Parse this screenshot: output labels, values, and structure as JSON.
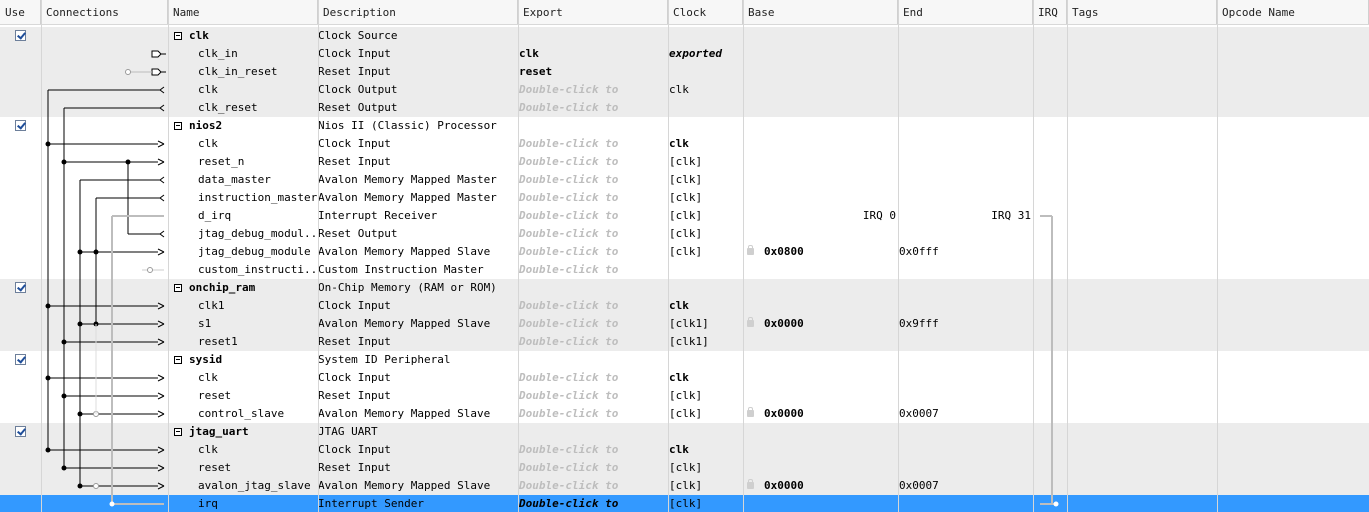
{
  "columns": [
    "Use",
    "Connections",
    "Name",
    "Description",
    "Export",
    "Clock",
    "Base",
    "End",
    "IRQ",
    "Tags",
    "Opcode Name"
  ],
  "placeholder_export": "Double-click to",
  "rows": [
    {
      "kind": "comp",
      "use": true,
      "name": "clk",
      "desc": "Clock Source",
      "export": "",
      "clock": "",
      "base": "",
      "end": "",
      "irq": ""
    },
    {
      "kind": "port",
      "name": "clk_in",
      "desc": "Clock Input",
      "export": "clk",
      "export_style": "bold",
      "clock": "exported",
      "clock_style": "italic"
    },
    {
      "kind": "port",
      "name": "clk_in_reset",
      "desc": "Reset Input",
      "export": "reset",
      "export_style": "bold",
      "clock": ""
    },
    {
      "kind": "port",
      "name": "clk",
      "desc": "Clock Output",
      "export": "Double-click to",
      "export_style": "placeholder",
      "clock": "clk"
    },
    {
      "kind": "port",
      "name": "clk_reset",
      "desc": "Reset Output",
      "export": "Double-click to",
      "export_style": "placeholder",
      "clock": ""
    },
    {
      "kind": "comp",
      "use": true,
      "name": "nios2",
      "desc": "Nios II (Classic) Processor"
    },
    {
      "kind": "port",
      "name": "clk",
      "desc": "Clock Input",
      "export": "Double-click to",
      "export_style": "placeholder",
      "clock": "clk",
      "clock_style": "bold"
    },
    {
      "kind": "port",
      "name": "reset_n",
      "desc": "Reset Input",
      "export": "Double-click to",
      "export_style": "placeholder",
      "clock": "[clk]"
    },
    {
      "kind": "port",
      "name": "data_master",
      "desc": "Avalon Memory Mapped Master",
      "export": "Double-click to",
      "export_style": "placeholder",
      "clock": "[clk]"
    },
    {
      "kind": "port",
      "name": "instruction_master",
      "desc": "Avalon Memory Mapped Master",
      "export": "Double-click to",
      "export_style": "placeholder",
      "clock": "[clk]"
    },
    {
      "kind": "port",
      "name": "d_irq",
      "desc": "Interrupt Receiver",
      "export": "Double-click to",
      "export_style": "placeholder",
      "clock": "[clk]",
      "base_right": "IRQ 0",
      "end_right": "IRQ 31"
    },
    {
      "kind": "port",
      "name": "jtag_debug_modul...",
      "desc": "Reset Output",
      "export": "Double-click to",
      "export_style": "placeholder",
      "clock": "[clk]"
    },
    {
      "kind": "port",
      "name": "jtag_debug_module",
      "desc": "Avalon Memory Mapped Slave",
      "export": "Double-click to",
      "export_style": "placeholder",
      "clock": "[clk]",
      "base": "0x0800",
      "end": "0x0fff"
    },
    {
      "kind": "port",
      "name": "custom_instructi...",
      "desc": "Custom Instruction Master",
      "export": "Double-click to",
      "export_style": "placeholder",
      "clock": ""
    },
    {
      "kind": "comp",
      "use": true,
      "name": "onchip_ram",
      "desc": "On-Chip Memory (RAM or ROM)"
    },
    {
      "kind": "port",
      "name": "clk1",
      "desc": "Clock Input",
      "export": "Double-click to",
      "export_style": "placeholder",
      "clock": "clk",
      "clock_style": "bold"
    },
    {
      "kind": "port",
      "name": "s1",
      "desc": "Avalon Memory Mapped Slave",
      "export": "Double-click to",
      "export_style": "placeholder",
      "clock": "[clk1]",
      "base": "0x0000",
      "end": "0x9fff"
    },
    {
      "kind": "port",
      "name": "reset1",
      "desc": "Reset Input",
      "export": "Double-click to",
      "export_style": "placeholder",
      "clock": "[clk1]"
    },
    {
      "kind": "comp",
      "use": true,
      "name": "sysid",
      "desc": "System ID Peripheral"
    },
    {
      "kind": "port",
      "name": "clk",
      "desc": "Clock Input",
      "export": "Double-click to",
      "export_style": "placeholder",
      "clock": "clk",
      "clock_style": "bold"
    },
    {
      "kind": "port",
      "name": "reset",
      "desc": "Reset Input",
      "export": "Double-click to",
      "export_style": "placeholder",
      "clock": "[clk]"
    },
    {
      "kind": "port",
      "name": "control_slave",
      "desc": "Avalon Memory Mapped Slave",
      "export": "Double-click to",
      "export_style": "placeholder",
      "clock": "[clk]",
      "base": "0x0000",
      "end": "0x0007"
    },
    {
      "kind": "comp",
      "use": true,
      "name": "jtag_uart",
      "desc": "JTAG UART"
    },
    {
      "kind": "port",
      "name": "clk",
      "desc": "Clock Input",
      "export": "Double-click to",
      "export_style": "placeholder",
      "clock": "clk",
      "clock_style": "bold"
    },
    {
      "kind": "port",
      "name": "reset",
      "desc": "Reset Input",
      "export": "Double-click to",
      "export_style": "placeholder",
      "clock": "[clk]"
    },
    {
      "kind": "port",
      "name": "avalon_jtag_slave",
      "desc": "Avalon Memory Mapped Slave",
      "export": "Double-click to",
      "export_style": "placeholder",
      "clock": "[clk]",
      "base": "0x0000",
      "end": "0x0007"
    },
    {
      "kind": "port",
      "name": "irq",
      "desc": "Interrupt Sender",
      "export": "Double-click to",
      "export_style": "placeholder",
      "clock": "[clk]",
      "selected": true
    }
  ],
  "colors": {
    "selected": "#3399ff",
    "group_bg": "#ececec",
    "wire": "#000000",
    "irq_wire": "#bdbdbd",
    "placeholder": "#bdbdbd"
  }
}
